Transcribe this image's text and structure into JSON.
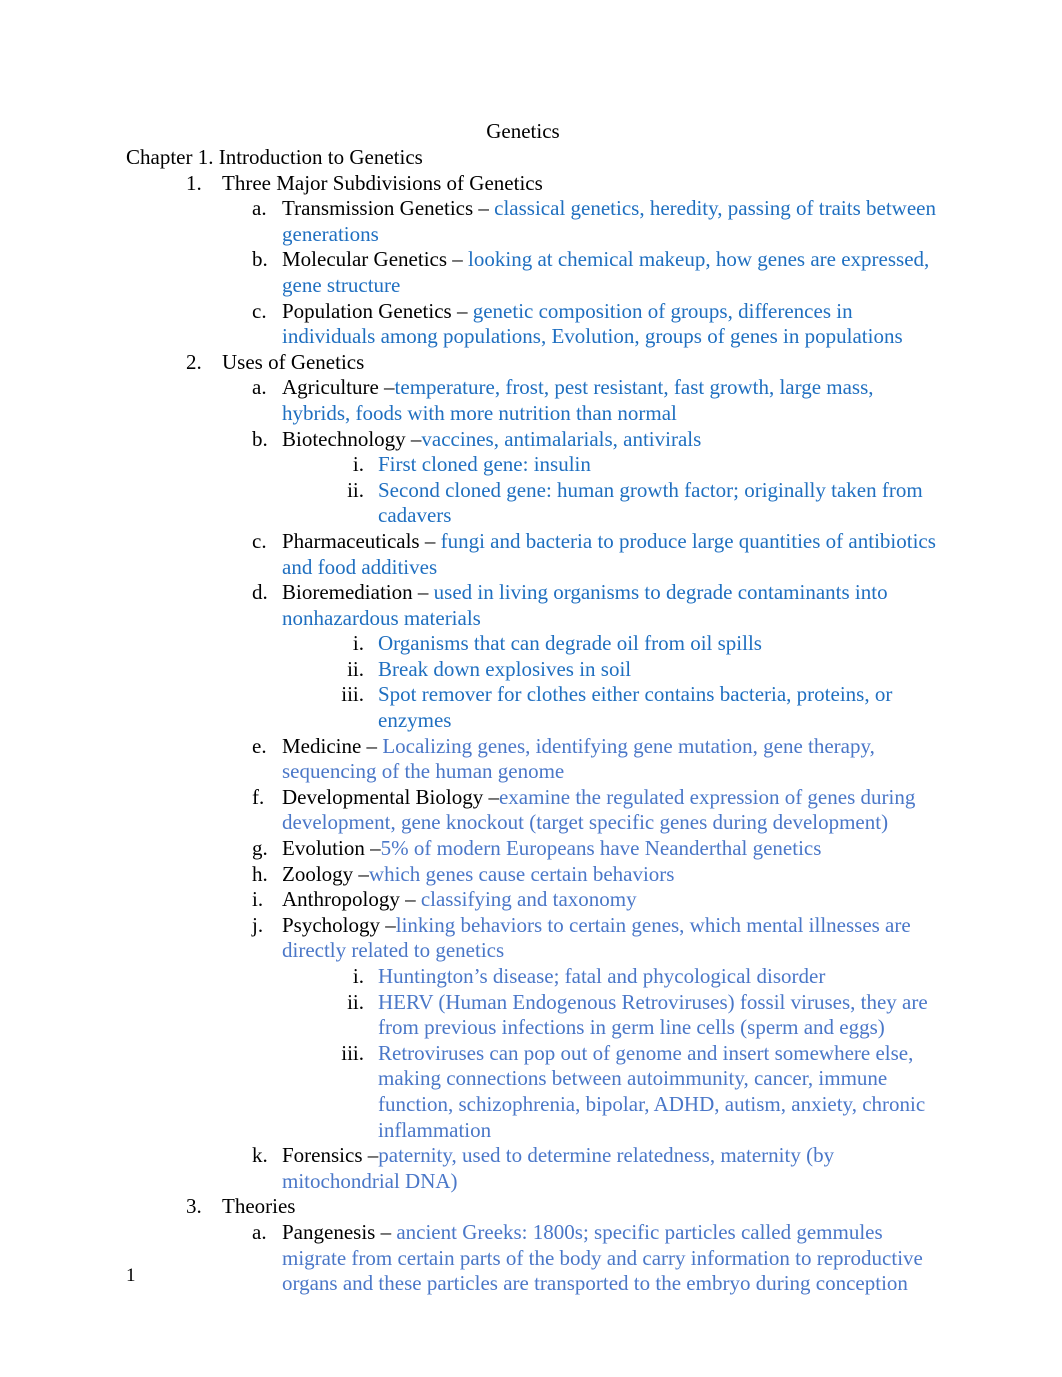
{
  "document": {
    "title": "Genetics",
    "page_number": "1",
    "colors": {
      "text": "#000000",
      "blue_strong": "#1F6FC0",
      "blue_light": "#4A77C8"
    }
  },
  "chapter": {
    "heading": "Chapter 1. Introduction to Genetics"
  },
  "sections": [
    {
      "marker": "1.",
      "heading": "Three Major Subdivisions of Genetics",
      "items": [
        {
          "marker": "a.",
          "term": "Transmission Genetics – ",
          "detail": "classical genetics, heredity, passing of traits between generations",
          "shade": "strong"
        },
        {
          "marker": "b.",
          "term": "Molecular Genetics – ",
          "detail": "looking at chemical makeup, how genes are expressed, gene structure",
          "shade": "strong"
        },
        {
          "marker": "c.",
          "term": "Population Genetics – ",
          "detail": "genetic composition of groups, differences in individuals among populations, Evolution, groups of genes in populations",
          "shade": "strong"
        }
      ]
    },
    {
      "marker": "2.",
      "heading": "Uses of Genetics",
      "items": [
        {
          "marker": "a.",
          "term": "Agriculture –",
          "detail": "temperature, frost, pest resistant, fast growth, large mass, hybrids, foods with more nutrition than normal",
          "shade": "strong"
        },
        {
          "marker": "b.",
          "term": "Biotechnology –",
          "detail": "vaccines, antimalarials, antivirals",
          "shade": "strong",
          "sub": [
            {
              "marker": "i.",
              "text": "First cloned gene: insulin",
              "shade": "strong"
            },
            {
              "marker": "ii.",
              "text": "Second cloned gene: human growth factor; originally taken from cadavers",
              "shade": "strong"
            }
          ]
        },
        {
          "marker": "c.",
          "term": "Pharmaceuticals – ",
          "detail": "fungi and bacteria to produce large quantities of antibiotics and food additives",
          "shade": "strong"
        },
        {
          "marker": "d.",
          "term": "Bioremediation – ",
          "detail": "used in living organisms to degrade contaminants into nonhazardous materials",
          "shade": "strong",
          "sub": [
            {
              "marker": "i.",
              "text": "Organisms that can degrade oil from oil spills",
              "shade": "strong"
            },
            {
              "marker": "ii.",
              "text": "Break down explosives in soil",
              "shade": "strong"
            },
            {
              "marker": "iii.",
              "text": "Spot remover for clothes either contains bacteria, proteins, or enzymes",
              "shade": "strong"
            }
          ]
        },
        {
          "marker": "e.",
          "term": "Medicine – ",
          "detail": "Localizing genes, identifying gene mutation, gene therapy, sequencing of the human genome",
          "shade": "light"
        },
        {
          "marker": "f.",
          "term": "Developmental Biology –",
          "detail": "examine the regulated expression of genes during development, gene knockout (target specific genes during development)",
          "shade": "light"
        },
        {
          "marker": "g.",
          "term": "Evolution –",
          "detail": "5% of modern Europeans have Neanderthal genetics",
          "shade": "light"
        },
        {
          "marker": "h.",
          "term": "Zoology –",
          "detail": "which genes cause certain behaviors",
          "shade": "light"
        },
        {
          "marker": "i.",
          "term": "Anthropology – ",
          "detail": "classifying and taxonomy",
          "shade": "light"
        },
        {
          "marker": "j.",
          "term": "Psychology –",
          "detail": "linking behaviors to certain genes, which mental illnesses are directly related to genetics",
          "shade": "light",
          "sub": [
            {
              "marker": "i.",
              "text": "Huntington’s disease; fatal and phycological disorder",
              "shade": "light"
            },
            {
              "marker": "ii.",
              "text": "HERV (Human Endogenous Retroviruses) fossil viruses, they are from previous infections in germ line cells (sperm and eggs)",
              "shade": "light"
            },
            {
              "marker": "iii.",
              "text": "Retroviruses can pop out of genome and insert somewhere else, making connections between autoimmunity, cancer, immune function, schizophrenia, bipolar, ADHD, autism, anxiety, chronic inflammation",
              "shade": "light"
            }
          ]
        },
        {
          "marker": "k.",
          "term": "Forensics –",
          "detail": "paternity, used to determine relatedness, maternity (by mitochondrial DNA)",
          "shade": "light"
        }
      ]
    },
    {
      "marker": "3.",
      "heading": "Theories",
      "items": [
        {
          "marker": "a.",
          "term": "Pangenesis – ",
          "detail": "ancient Greeks: 1800s; specific particles called gemmules migrate from certain parts of the body and carry information to reproductive organs and these particles are transported to the embryo during conception",
          "shade": "light"
        }
      ]
    }
  ]
}
